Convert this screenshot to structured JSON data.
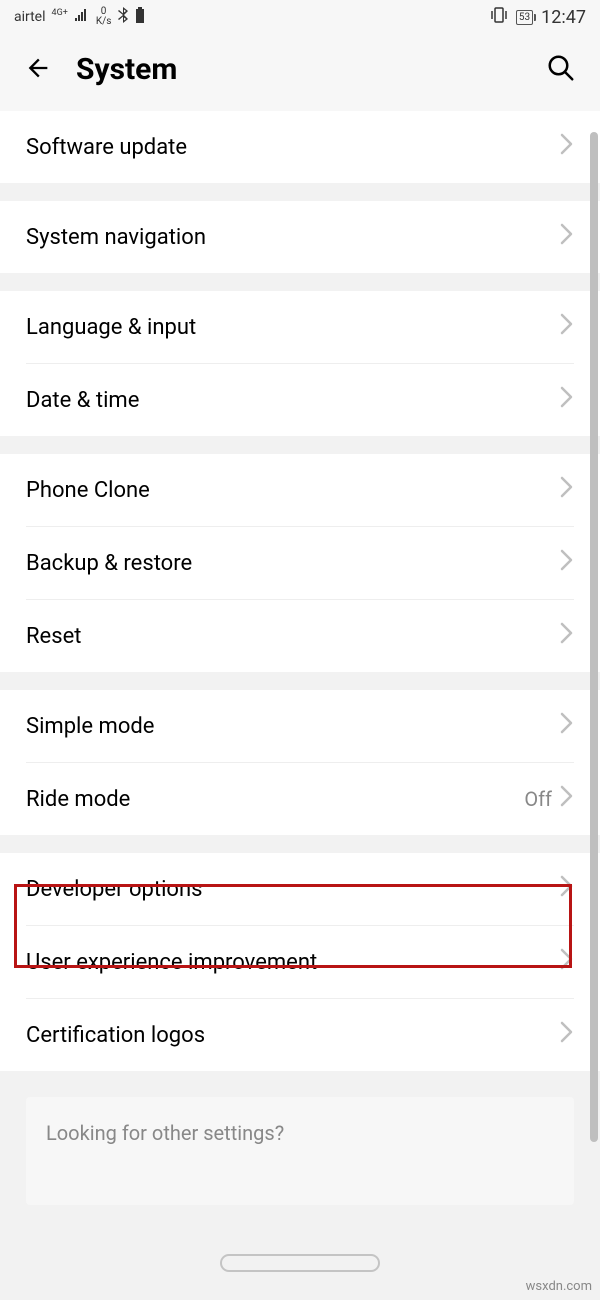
{
  "status": {
    "carrier": "airtel",
    "network_sup": "4G+",
    "speed_top": "0",
    "speed_bot": "K/s",
    "battery": "53",
    "time": "12:47"
  },
  "header": {
    "title": "System"
  },
  "groups": [
    {
      "items": [
        {
          "label": "Software update"
        }
      ]
    },
    {
      "items": [
        {
          "label": "System navigation"
        }
      ]
    },
    {
      "items": [
        {
          "label": "Language & input"
        },
        {
          "label": "Date & time"
        }
      ]
    },
    {
      "items": [
        {
          "label": "Phone Clone"
        },
        {
          "label": "Backup & restore"
        },
        {
          "label": "Reset"
        }
      ]
    },
    {
      "items": [
        {
          "label": "Simple mode"
        },
        {
          "label": "Ride mode",
          "value": "Off"
        }
      ]
    },
    {
      "items": [
        {
          "label": "Developer options"
        },
        {
          "label": "User experience improvement"
        },
        {
          "label": "Certification logos"
        }
      ]
    }
  ],
  "footer": {
    "text": "Looking for other settings?"
  },
  "watermark": "wsxdn.com"
}
